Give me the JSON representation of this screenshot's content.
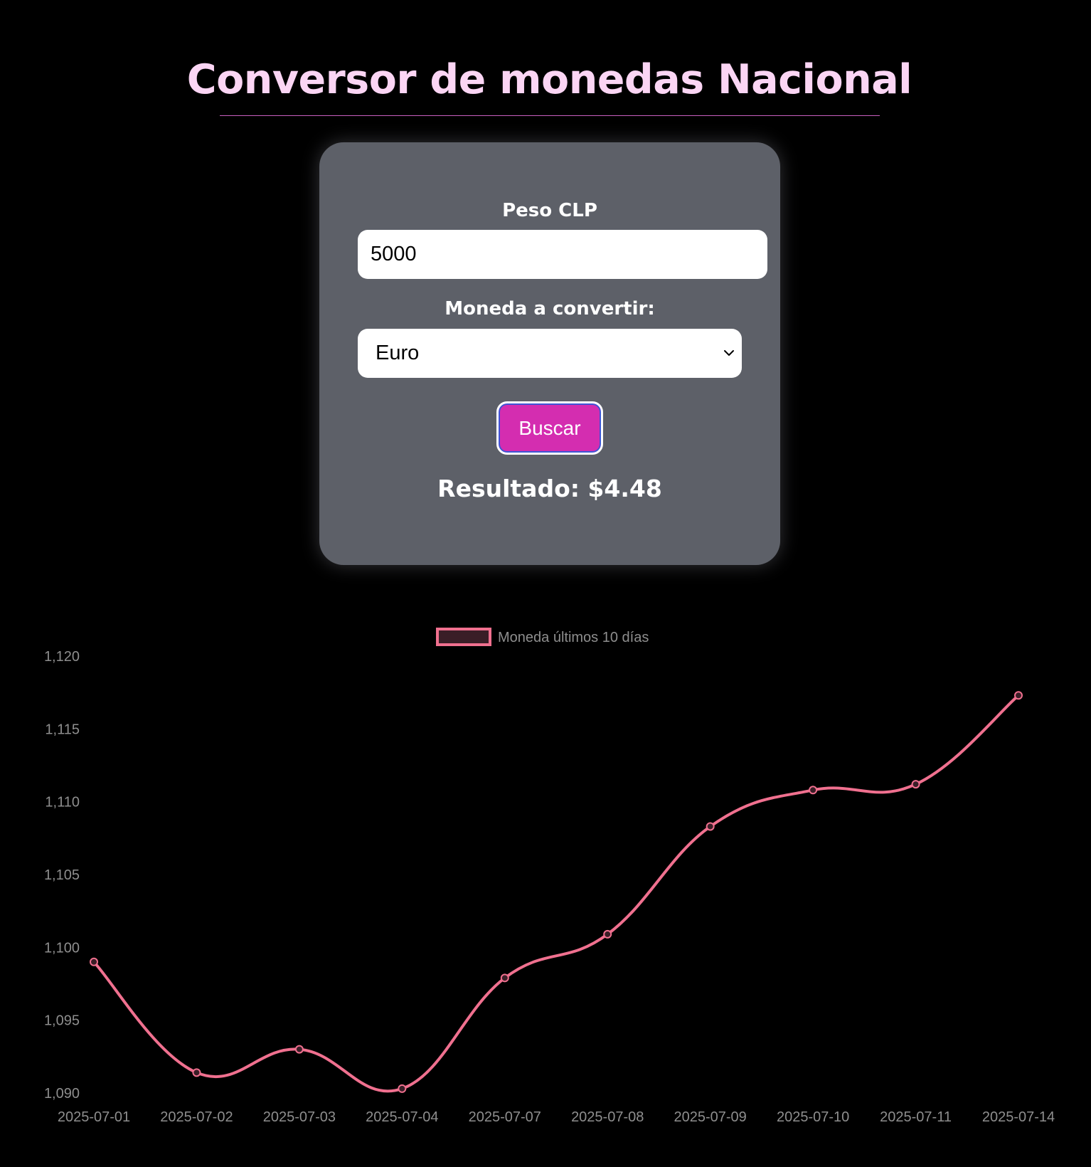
{
  "header": {
    "title": "Conversor de monedas Nacional"
  },
  "form": {
    "amount_label": "Peso CLP",
    "amount_value": "5000",
    "currency_label": "Moneda a convertir:",
    "currency_selected": "Euro",
    "search_label": "Buscar",
    "result_text": "Resultado: $4.48"
  },
  "colors": {
    "title": "#fbd5f4",
    "card_background": "#5d6068",
    "button_background": "#d42db0",
    "line": "#f0708f",
    "legend_fill": "#3a1e27"
  },
  "chart_data": {
    "type": "line",
    "categories": [
      "2025-07-01",
      "2025-07-02",
      "2025-07-03",
      "2025-07-04",
      "2025-07-07",
      "2025-07-08",
      "2025-07-09",
      "2025-07-10",
      "2025-07-11",
      "2025-07-14"
    ],
    "series": [
      {
        "name": "Moneda últimos 10 días",
        "values": [
          1099.0,
          1091.4,
          1093.0,
          1090.3,
          1097.9,
          1100.9,
          1108.3,
          1110.8,
          1111.2,
          1117.3
        ]
      }
    ],
    "ylim": [
      1090,
      1120
    ],
    "yticks": [
      "1,090",
      "1,095",
      "1,100",
      "1,105",
      "1,110",
      "1,115",
      "1,120"
    ],
    "ytick_values": [
      1090,
      1095,
      1100,
      1105,
      1110,
      1115,
      1120
    ],
    "legend_position": "top-center",
    "grid": false
  }
}
